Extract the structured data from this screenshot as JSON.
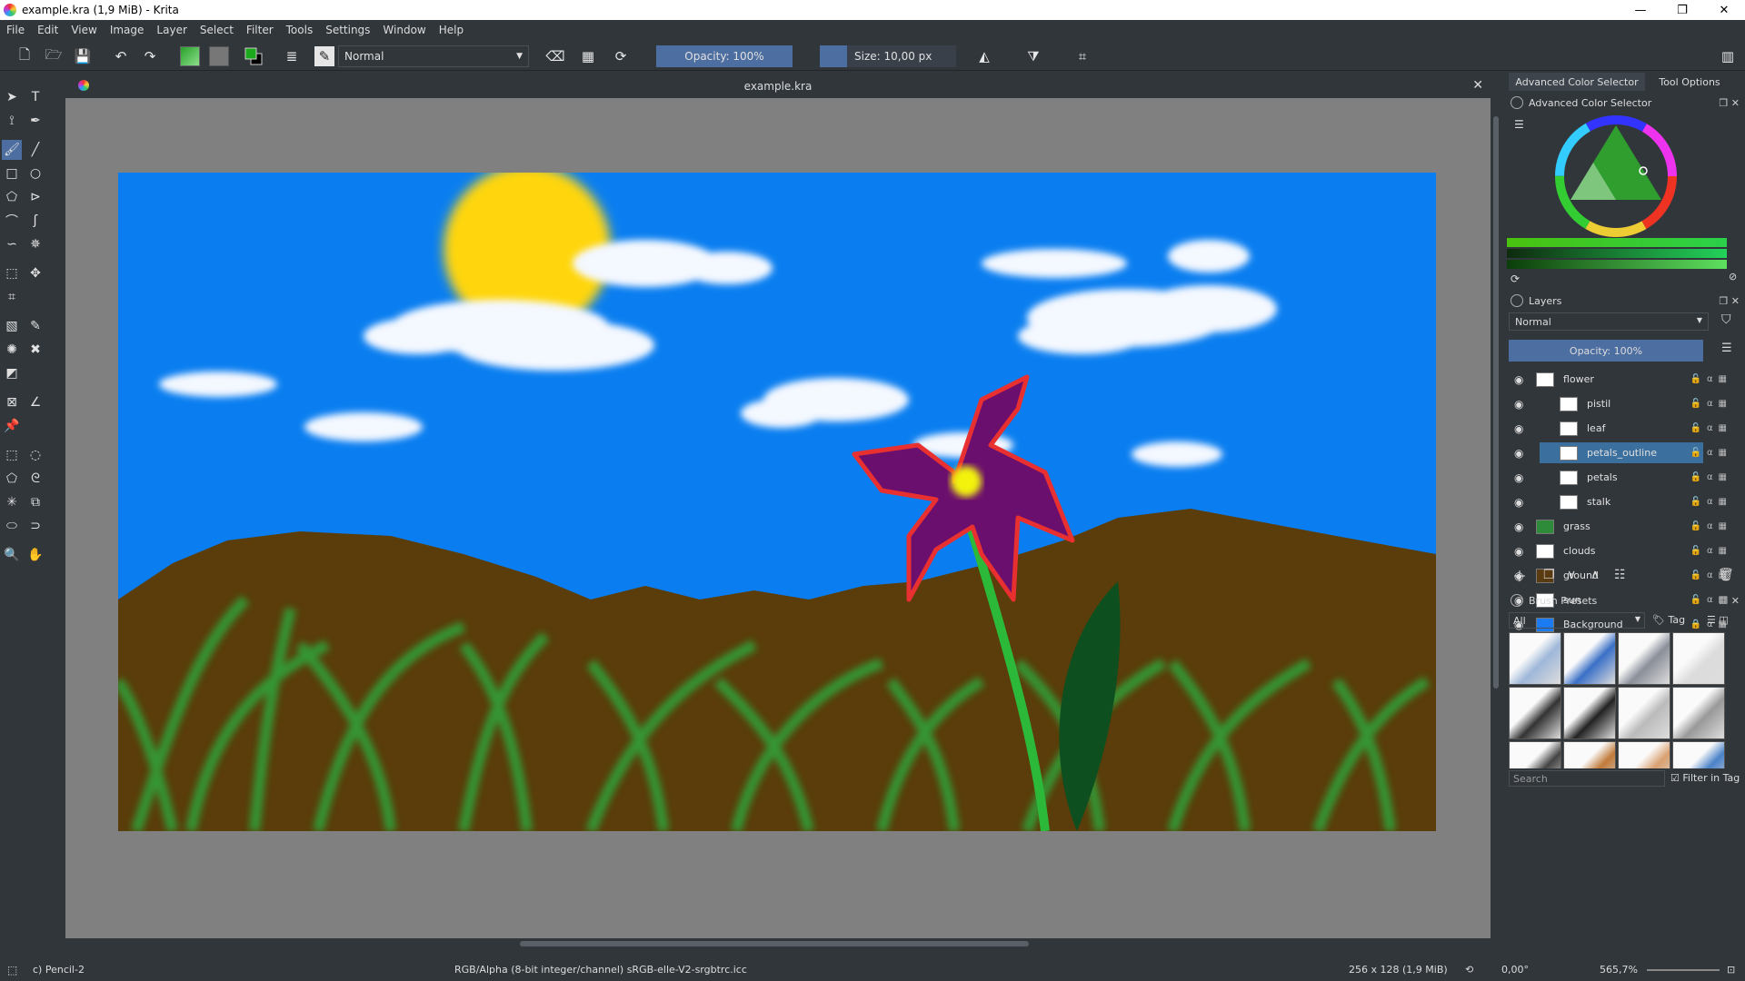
{
  "window": {
    "title": "example.kra (1,9 MiB)  - Krita",
    "min": "—",
    "max": "❐",
    "close": "✕"
  },
  "menu": [
    "File",
    "Edit",
    "View",
    "Image",
    "Layer",
    "Select",
    "Filter",
    "Tools",
    "Settings",
    "Window",
    "Help"
  ],
  "toolbar": {
    "blend_mode": "Normal",
    "opacity": "Opacity: 100%",
    "size": "Size: 10,00 px"
  },
  "document": {
    "tab_title": "example.kra",
    "close": "✕"
  },
  "dock": {
    "tabs": [
      "Advanced Color Selector",
      "Tool Options"
    ],
    "color_selector_title": "Advanced Color Selector",
    "layers_title": "Layers",
    "layers_blend_mode": "Normal",
    "layers_opacity": "Opacity:  100%",
    "layers": [
      {
        "name": "flower",
        "indent": 0,
        "group": true,
        "thumb": "#ffffff"
      },
      {
        "name": "pistil",
        "indent": 1,
        "thumb": "#ffffff"
      },
      {
        "name": "leaf",
        "indent": 1,
        "thumb": "#ffffff"
      },
      {
        "name": "petals_outline",
        "indent": 1,
        "selected": true,
        "thumb": "#ffffff"
      },
      {
        "name": "petals",
        "indent": 1,
        "thumb": "#ffffff"
      },
      {
        "name": "stalk",
        "indent": 1,
        "thumb": "#ffffff"
      },
      {
        "name": "grass",
        "indent": 0,
        "thumb": "#2e8b3a"
      },
      {
        "name": "clouds",
        "indent": 0,
        "thumb": "#ffffff"
      },
      {
        "name": "ground",
        "indent": 0,
        "thumb": "#5a3a10"
      },
      {
        "name": "sun",
        "indent": 0,
        "thumb": "#ffffff"
      },
      {
        "name": "Background",
        "indent": 0,
        "thumb": "#1a7cf0",
        "locked": true
      }
    ],
    "brush_presets_title": "Brush Presets",
    "brush_filter": "All",
    "tag_label": "Tag",
    "search_placeholder": "Search",
    "filter_in_tag": "Filter in Tag"
  },
  "status": {
    "brush": "c) Pencil-2",
    "color_space": "RGB/Alpha (8-bit integer/channel)  sRGB-elle-V2-srgbtrc.icc",
    "image_size": "256 x 128 (1,9 MiB)",
    "rotation": "0,00°",
    "zoom": "565,7%"
  },
  "colors": {
    "sky": "#0a7ef0",
    "ground": "#5a3d0a",
    "grass": "#2fa53a",
    "sun": "#ffd60a",
    "petals": "#6b0f6e",
    "petals_outline": "#e83030"
  }
}
